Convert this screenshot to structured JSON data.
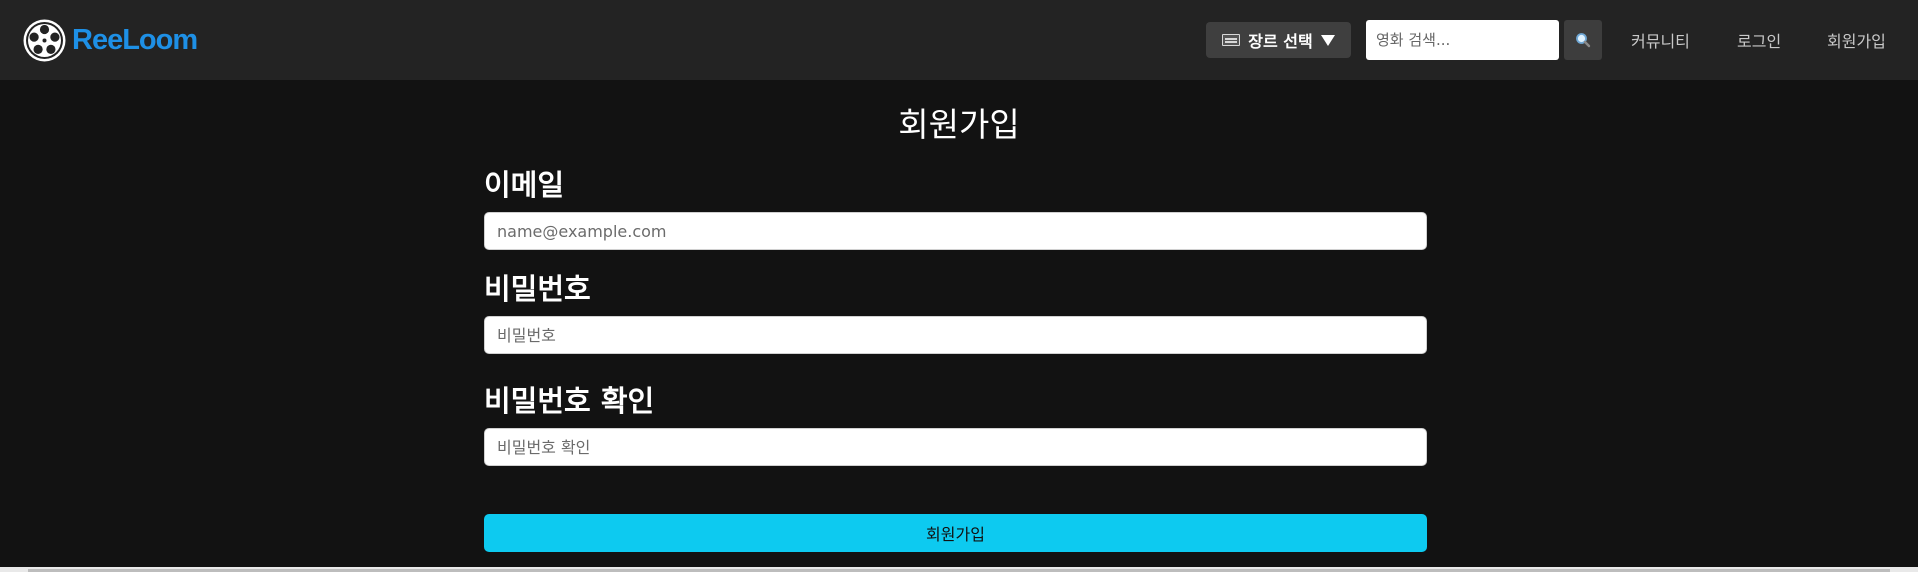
{
  "app": {
    "brand_name": "ReeLoom",
    "accent_color": "#1e90e6"
  },
  "navbar": {
    "genre_button_label": "장르 선택",
    "genre_icon": "film-icon",
    "search": {
      "placeholder": "영화 검색...",
      "value": "",
      "button_icon": "search-icon"
    },
    "links": {
      "community": "커뮤니티",
      "login": "로그인",
      "signup": "회원가입"
    }
  },
  "form": {
    "title": "회원가입",
    "email": {
      "label": "이메일",
      "placeholder": "name@example.com",
      "value": ""
    },
    "password": {
      "label": "비밀번호",
      "placeholder": "비밀번호",
      "value": ""
    },
    "password_confirm": {
      "label": "비밀번호 확인",
      "placeholder": "비밀번호 확인",
      "value": ""
    },
    "submit_label": "회원가입",
    "submit_color": "#0dcaf0"
  }
}
